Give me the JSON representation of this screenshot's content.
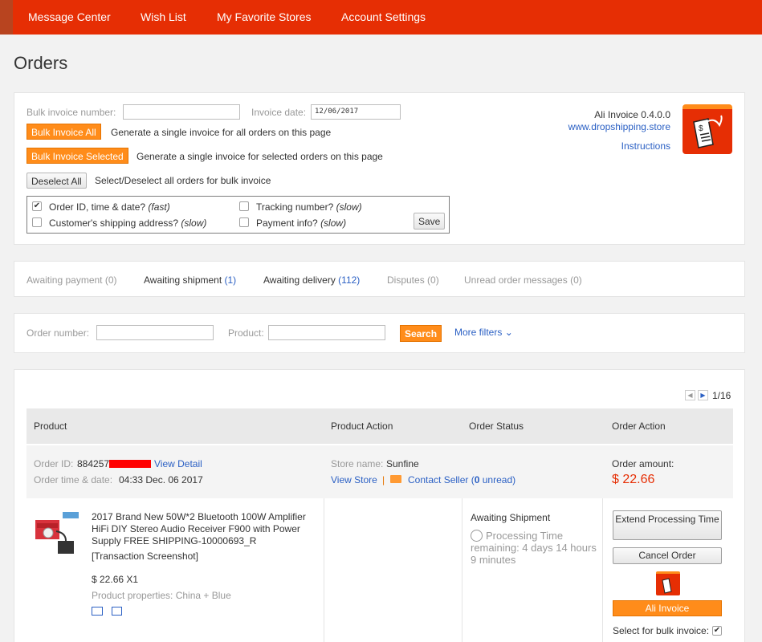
{
  "nav": {
    "items": [
      "Message Center",
      "Wish List",
      "My Favorite Stores",
      "Account Settings"
    ]
  },
  "page_title": "Orders",
  "invoice_panel": {
    "bulk_invoice_number_label": "Bulk invoice number:",
    "bulk_invoice_number_value": "",
    "invoice_date_label": "Invoice date:",
    "invoice_date_value": "12/06/2017",
    "bulk_all_button": "Bulk Invoice All",
    "bulk_all_desc": "Generate a single invoice for all orders on this page",
    "bulk_selected_button": "Bulk Invoice Selected",
    "bulk_selected_desc": "Generate a single invoice for selected orders on this page",
    "deselect_button": "Deselect All",
    "deselect_desc": "Select/Deselect all orders for bulk invoice",
    "options": {
      "order_id": {
        "label": "Order ID, time & date?",
        "speed": "(fast)",
        "checked": true
      },
      "shipping_address": {
        "label": "Customer's shipping address?",
        "speed": "(slow)",
        "checked": false
      },
      "tracking": {
        "label": "Tracking number?",
        "speed": "(slow)",
        "checked": false
      },
      "payment": {
        "label": "Payment info?",
        "speed": "(slow)",
        "checked": false
      }
    },
    "save_button": "Save",
    "app_name": "Ali Invoice 0.4.0.0",
    "app_site": "www.dropshipping.store",
    "instructions_link": "Instructions",
    "check_glyph": "✔"
  },
  "tabs": [
    {
      "label": "Awaiting payment",
      "count": "(0)",
      "active": false
    },
    {
      "label": "Awaiting shipment",
      "count": "(1)",
      "active": true
    },
    {
      "label": "Awaiting delivery",
      "count": "(112)",
      "active": true
    },
    {
      "label": "Disputes",
      "count": "(0)",
      "active": false
    },
    {
      "label": "Unread order messages",
      "count": "(0)",
      "active": false
    }
  ],
  "filters": {
    "order_number_label": "Order number:",
    "product_label": "Product:",
    "search_button": "Search",
    "more_filters": "More filters"
  },
  "orders": {
    "pager": "1/16",
    "columns": [
      "Product",
      "Product Action",
      "Order Status",
      "Order Action"
    ],
    "order": {
      "id_label": "Order ID:",
      "id_value": "884257",
      "view_detail": "View Detail",
      "time_label": "Order time & date:",
      "time_value": "04:33 Dec. 06 2017",
      "store_label": "Store name:",
      "store_value": "Sunfine",
      "view_store": "View Store",
      "separator": "|",
      "contact_seller": "Contact Seller",
      "unread_count": "0",
      "unread_label": "unread",
      "amount_label": "Order amount:",
      "amount_value": "$ 22.66",
      "product_title": "2017 Brand New 50W*2 Bluetooth 100W Amplifier HiFi DIY Stereo Audio Receiver F900 with Power Supply FREE SHIPPING-10000693_R",
      "transaction_screenshot": "[Transaction Screenshot]",
      "price": "$ 22.66 X1",
      "properties": "Product properties: China + Blue",
      "status": "Awaiting Shipment",
      "processing_time": "Processing Time remaining: 4 days 14 hours 9 minutes",
      "extend_button": "Extend Processing Time",
      "cancel_button": "Cancel Order",
      "ali_invoice_button": "Ali Invoice",
      "bulk_select_label": "Select for bulk invoice:",
      "bulk_select_checked": true
    }
  },
  "colors": {
    "brand_red": "#e62e04",
    "accent_orange": "#ff8c1a",
    "link_blue": "#2b60c4",
    "price_red": "#e62e04"
  }
}
